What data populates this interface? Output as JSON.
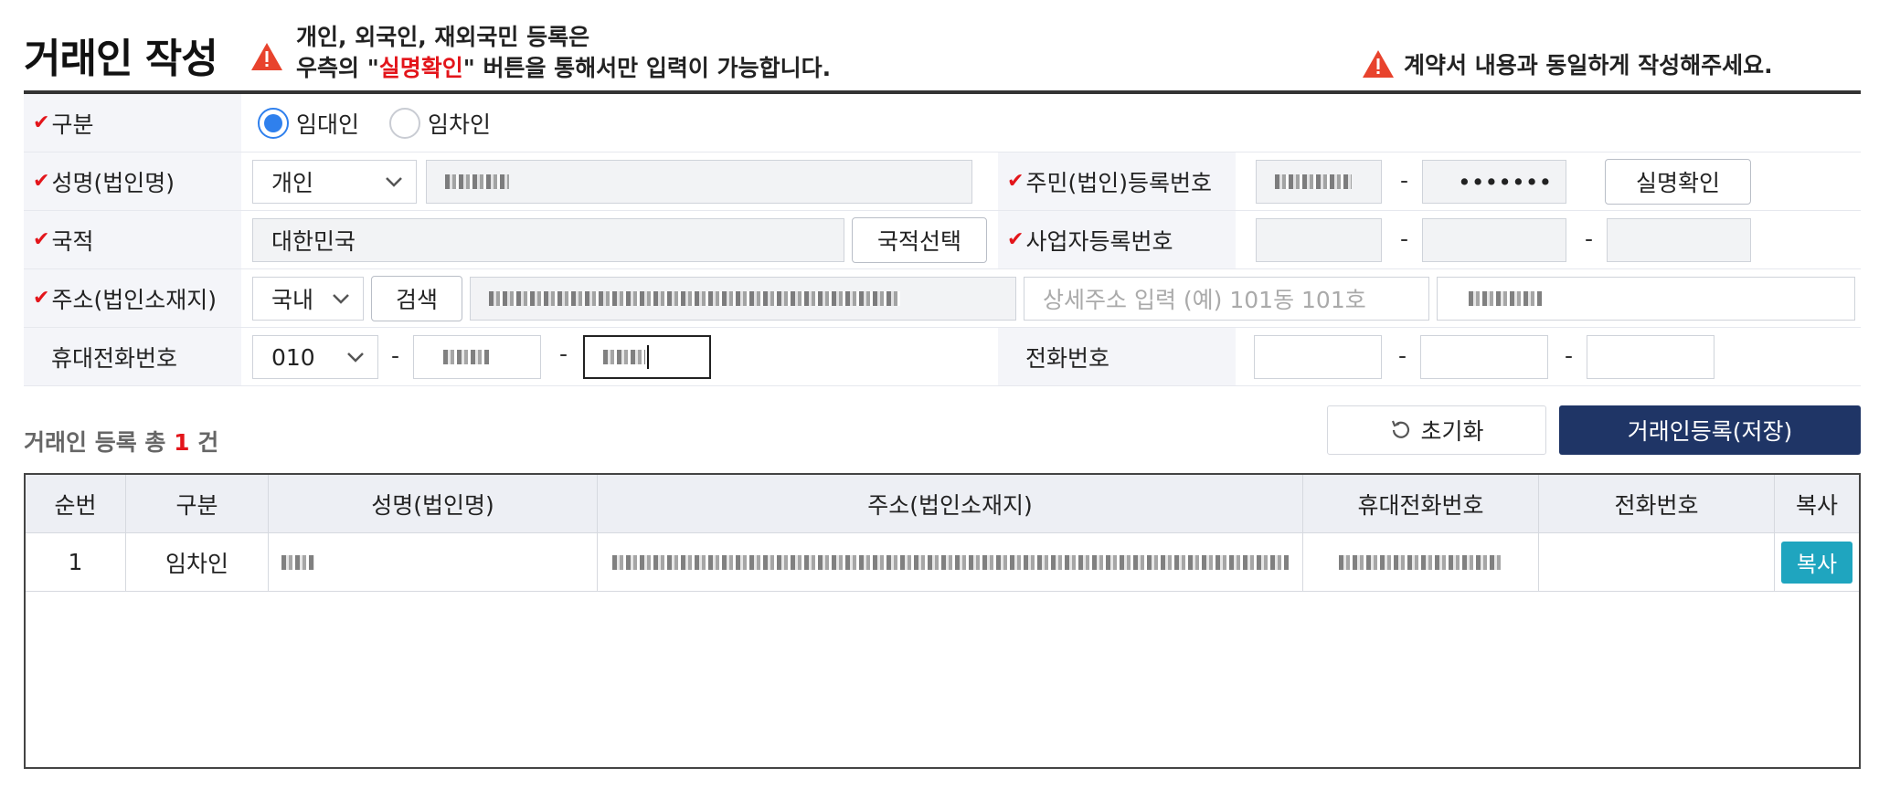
{
  "header": {
    "title": "거래인 작성",
    "notice_line1": "개인, 외국인, 재외국민 등록은",
    "notice_line2_prefix": "우측의 \"",
    "notice_line2_highlight": "실명확인",
    "notice_line2_suffix": "\" 버튼을 통해서만 입력이 가능합니다.",
    "notice_right": "계약서 내용과 동일하게 작성해주세요."
  },
  "form": {
    "type_label": "구분",
    "type_options": [
      "임대인",
      "임차인"
    ],
    "type_selected": "임대인",
    "name_label": "성명(법인명)",
    "name_type_value": "개인",
    "id_label": "주민(법인)등록번호",
    "id_second_value": "•••••••",
    "verify_button": "실명확인",
    "nation_label": "국적",
    "nation_value": "대한민국",
    "nation_button": "국적선택",
    "biz_label": "사업자등록번호",
    "address_label": "주소(법인소재지)",
    "address_scope": "국내",
    "search_button": "검색",
    "address_detail_placeholder": "상세주소 입력 (예) 101동 101호",
    "mobile_label": "휴대전화번호",
    "mobile_prefix": "010",
    "phone_label": "전화번호",
    "dash": "-"
  },
  "summary": {
    "prefix": "거래인 등록 총 ",
    "count": "1",
    "suffix": " 건",
    "reset_button": "초기화",
    "save_button": "거래인등록(저장)"
  },
  "table": {
    "headers": [
      "순번",
      "구분",
      "성명(법인명)",
      "주소(법인소재지)",
      "휴대전화번호",
      "전화번호",
      "복사"
    ],
    "rows": [
      {
        "no": "1",
        "type": "임차인",
        "copy": "복사"
      }
    ]
  },
  "colors": {
    "accent_red": "#e3151b",
    "primary_navy": "#1f3566",
    "radio_blue": "#2f80ed",
    "copy_teal": "#1fa5bf"
  }
}
